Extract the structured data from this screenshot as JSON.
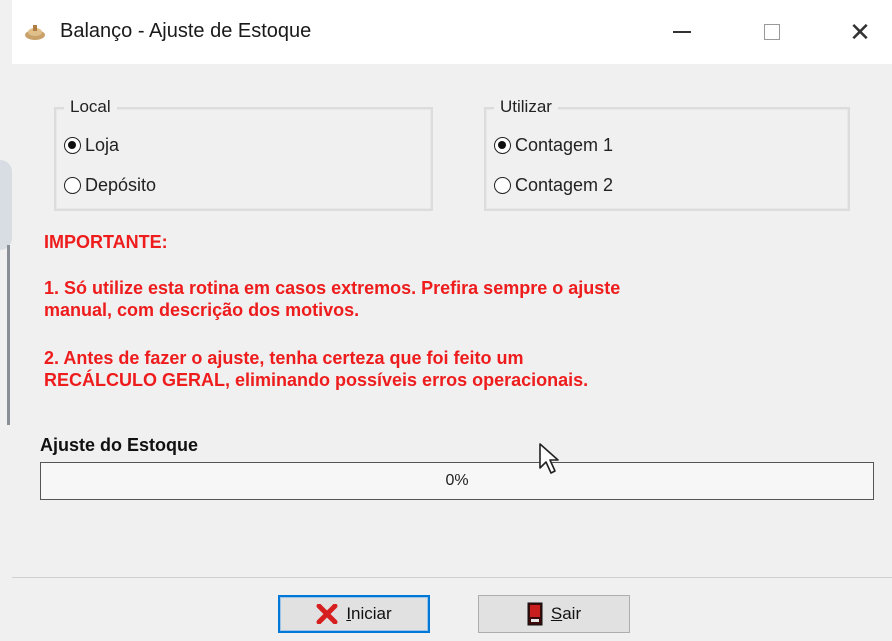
{
  "window": {
    "title": "Balanço - Ajuste de Estoque",
    "controls": {
      "minimize": "—",
      "maximize": "☐",
      "close": "✕"
    }
  },
  "local_group": {
    "label": "Local",
    "options": [
      {
        "label": "Loja",
        "checked": true
      },
      {
        "label": "Depósito",
        "checked": false
      }
    ]
  },
  "utilizar_group": {
    "label": "Utilizar",
    "options": [
      {
        "label": "Contagem 1",
        "checked": true
      },
      {
        "label": "Contagem 2",
        "checked": false
      }
    ]
  },
  "warning": {
    "heading": "IMPORTANTE:",
    "item1_line1": "1. Só utilize esta rotina em casos extremos. Prefira sempre o ajuste",
    "item1_line2": "manual, com descrição dos motivos.",
    "item2_line1": "2. Antes de fazer o ajuste, tenha certeza que foi feito um",
    "item2_line2": "RECÁLCULO GERAL, eliminando possíveis erros operacionais.",
    "color": "#ee1c1c"
  },
  "progress": {
    "label": "Ajuste do Estoque",
    "value": 0,
    "text": "0%"
  },
  "buttons": {
    "iniciar": {
      "first": "I",
      "rest": "niciar",
      "icon": "red-x-icon"
    },
    "sair": {
      "first": "S",
      "rest": "air",
      "icon": "exit-door-icon"
    }
  }
}
